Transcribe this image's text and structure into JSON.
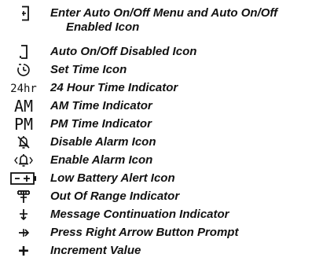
{
  "legend": {
    "items": [
      {
        "icon": "auto-on-off-enabled-icon",
        "label_line1": "Enter Auto On/Off Menu and Auto On/Off",
        "label_line2": "Enabled Icon"
      },
      {
        "icon": "auto-on-off-disabled-icon",
        "label": "Auto On/Off Disabled Icon"
      },
      {
        "icon": "set-time-icon",
        "label": "Set Time Icon"
      },
      {
        "icon": "24-hour-indicator",
        "glyph": "24hr",
        "label": "24 Hour Time Indicator"
      },
      {
        "icon": "am-indicator",
        "glyph": "AM",
        "label": "AM Time Indicator"
      },
      {
        "icon": "pm-indicator",
        "glyph": "PM",
        "label": "PM Time Indicator"
      },
      {
        "icon": "disable-alarm-icon",
        "label": "Disable Alarm Icon"
      },
      {
        "icon": "enable-alarm-icon",
        "label": "Enable Alarm Icon"
      },
      {
        "icon": "low-battery-icon",
        "label": "Low Battery Alert Icon"
      },
      {
        "icon": "out-of-range-icon",
        "label": "Out Of Range Indicator"
      },
      {
        "icon": "message-continuation-icon",
        "label": "Message Continuation Indicator"
      },
      {
        "icon": "right-arrow-prompt-icon",
        "label": "Press Right Arrow Button Prompt"
      },
      {
        "icon": "increment-icon",
        "glyph": "+",
        "label": "Increment Value"
      }
    ]
  }
}
